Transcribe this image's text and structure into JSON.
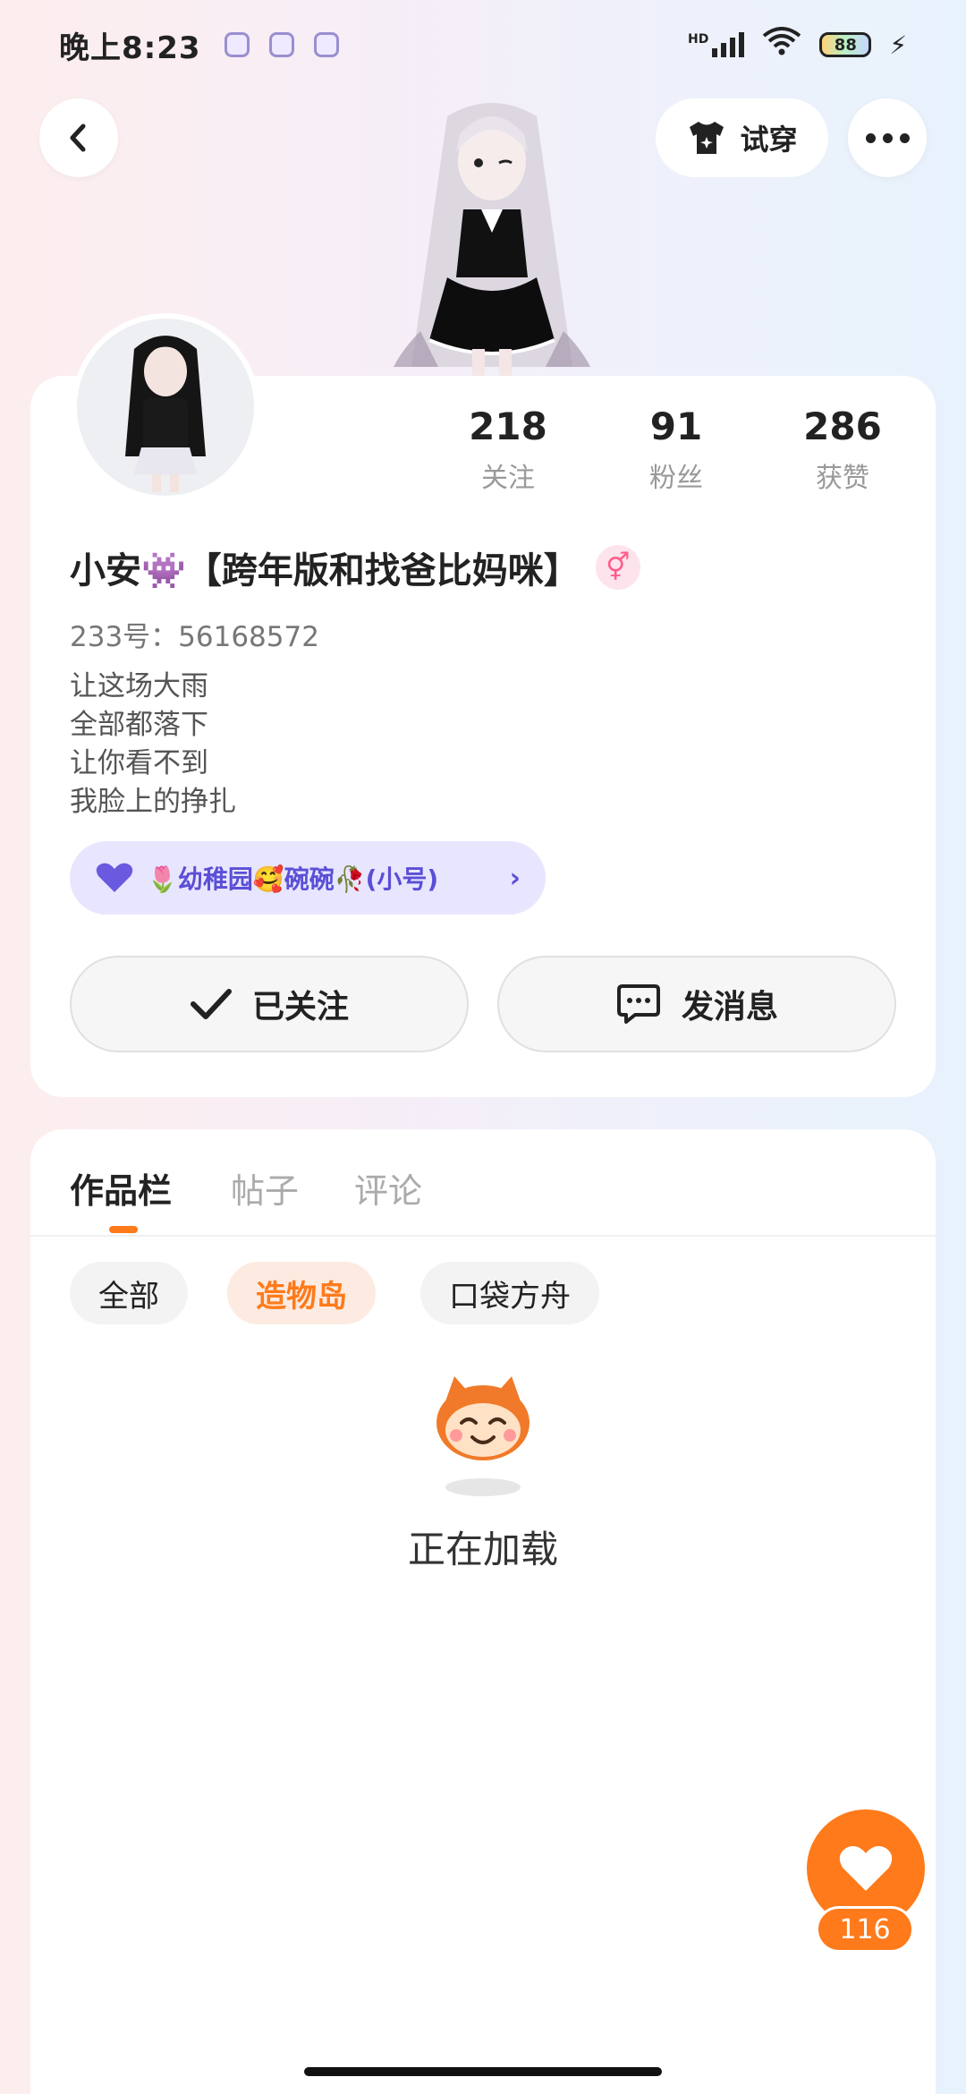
{
  "status_bar": {
    "time": "晚上8:23",
    "hd_label": "HD",
    "battery": "88"
  },
  "header": {
    "try_on_label": "试穿"
  },
  "profile": {
    "stats": [
      {
        "value": "218",
        "label": "关注"
      },
      {
        "value": "91",
        "label": "粉丝"
      },
      {
        "value": "286",
        "label": "获赞"
      }
    ],
    "nickname": "小安👾【跨年版和找爸比妈咪】",
    "gender_symbol": "⚥",
    "user_id": "233号：56168572",
    "bio_lines": [
      "让这场大雨",
      "全部都落下",
      "让你看不到",
      "我脸上的挣扎"
    ],
    "club_label": "🌷幼稚园🥰碗碗🥀(小号)",
    "follow_label": "已关注",
    "message_label": "发消息"
  },
  "works": {
    "tabs": [
      "作品栏",
      "帖子",
      "评论"
    ],
    "active_tab": "作品栏",
    "chips": [
      "全部",
      "造物岛",
      "口袋方舟"
    ],
    "active_chip": "造物岛",
    "loading_text": "正在加载"
  },
  "like": {
    "count": "116"
  },
  "colors": {
    "accent": "#ff7a1a",
    "club_bg": "#e8e6ff",
    "club_text": "#5b4fd6"
  }
}
